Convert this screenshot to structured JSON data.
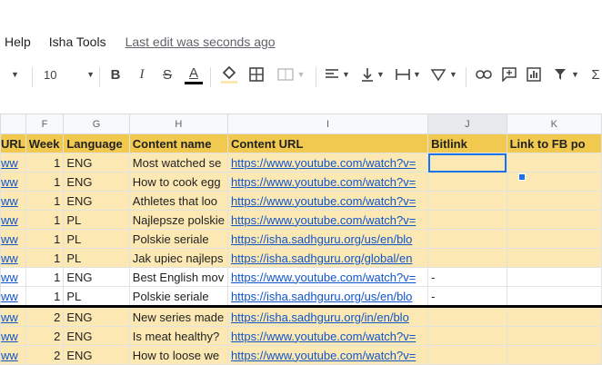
{
  "menu": {
    "help": "Help",
    "isha_tools": "Isha Tools",
    "last_edit": "Last edit was seconds ago"
  },
  "toolbar": {
    "font_size": "10",
    "bold": "B",
    "italic": "I",
    "strike": "S",
    "text_color": "A"
  },
  "columns": [
    "F",
    "G",
    "H",
    "I",
    "J",
    "K"
  ],
  "header_row": {
    "a": "URL",
    "week": "Week",
    "language": "Language",
    "content_name": "Content name",
    "content_url": "Content URL",
    "bitlink": "Bitlink",
    "fb": "Link to FB po"
  },
  "rows": [
    {
      "a": "ww",
      "week": "1",
      "lang": "ENG",
      "name": "Most watched se",
      "url": "https://www.youtube.com/watch?v=",
      "bitlink": ""
    },
    {
      "a": "ww",
      "week": "1",
      "lang": "ENG",
      "name": "How to cook egg",
      "url": "https://www.youtube.com/watch?v=",
      "bitlink": ""
    },
    {
      "a": "ww",
      "week": "1",
      "lang": "ENG",
      "name": "Athletes that loo",
      "url": "https://www.youtube.com/watch?v=",
      "bitlink": ""
    },
    {
      "a": "ww",
      "week": "1",
      "lang": "PL",
      "name": "Najlepsze polskie",
      "url": "https://www.youtube.com/watch?v=",
      "bitlink": ""
    },
    {
      "a": "ww",
      "week": "1",
      "lang": "PL",
      "name": "Polskie seriale",
      "url": "https://isha.sadhguru.org/us/en/blo",
      "bitlink": ""
    },
    {
      "a": "ww",
      "week": "1",
      "lang": "PL",
      "name": "Jak upiec najleps",
      "url": "https://isha.sadhguru.org/global/en",
      "bitlink": ""
    },
    {
      "a": "ww",
      "week": "1",
      "lang": "ENG",
      "name": "Best English mov",
      "url": "https://www.youtube.com/watch?v=",
      "bitlink": "-"
    },
    {
      "a": "ww",
      "week": "1",
      "lang": "PL",
      "name": "Polskie seriale",
      "url": "https://isha.sadhguru.org/us/en/blo",
      "bitlink": "-"
    },
    {
      "a": "ww",
      "week": "2",
      "lang": "ENG",
      "name": "New series made",
      "url": "https://isha.sadhguru.org/in/en/blo",
      "bitlink": ""
    },
    {
      "a": "ww",
      "week": "2",
      "lang": "ENG",
      "name": "Is meat healthy?",
      "url": "https://www.youtube.com/watch?v=",
      "bitlink": ""
    },
    {
      "a": "ww",
      "week": "2",
      "lang": "ENG",
      "name": "How to loose we",
      "url": "https://www.youtube.com/watch?v=",
      "bitlink": ""
    }
  ],
  "colors": {
    "header": "#f1c94f",
    "row_yellow": "#fce8b2",
    "link": "#1155cc",
    "selection": "#1a73e8"
  }
}
